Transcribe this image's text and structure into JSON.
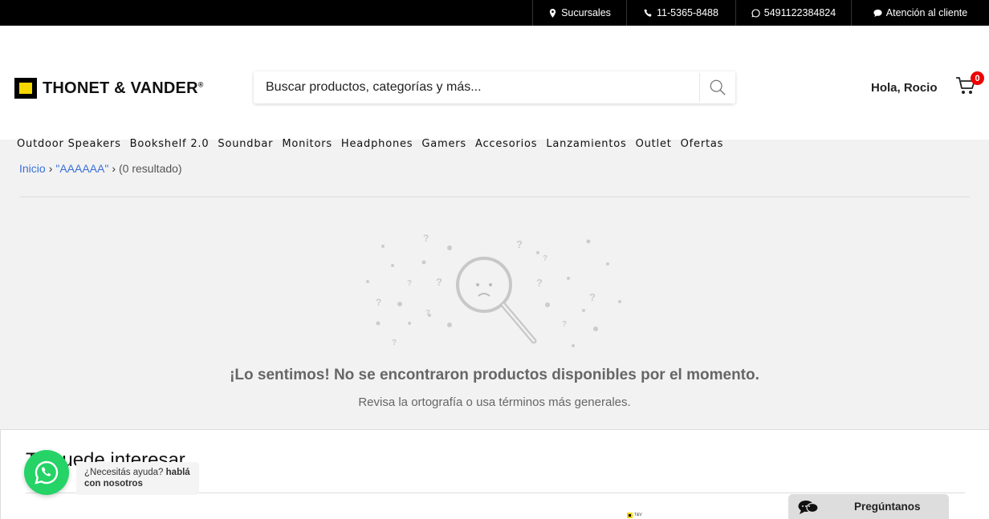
{
  "topbar": {
    "branches": "Sucursales",
    "phone": "11-5365-8488",
    "whatsapp": "5491122384824",
    "support": "Atención al cliente"
  },
  "header": {
    "logo_text": "THONET & VANDER",
    "search_placeholder": "Buscar productos, categorías y más...",
    "greeting": "Hola, Rocio",
    "cart_count": "0"
  },
  "nav": [
    "Outdoor Speakers",
    "Bookshelf 2.0",
    "Soundbar",
    "Monitors",
    "Headphones",
    "Gamers",
    "Accesorios",
    "Lanzamientos",
    "Outlet",
    "Ofertas"
  ],
  "breadcrumb": {
    "home": "Inicio",
    "query": "\"AAAAAA\"",
    "results": "(0 resultado)"
  },
  "empty_state": {
    "title": "¡Lo sentimos! No se encontraron productos disponibles por el momento.",
    "subtitle": "Revisa la ortografía o usa términos más generales."
  },
  "recommendations": {
    "title": "Te puede interesar"
  },
  "whatsapp_widget": {
    "text": "¿Necesitás ayuda?",
    "bold": "hablá con nosotros"
  },
  "ask_widget": {
    "label": "Pregúntanos"
  },
  "colors": {
    "brand_yellow": "#f5d800",
    "link_blue": "#3a6fd8",
    "badge_red": "#e00000",
    "whatsapp_green": "#25d366"
  }
}
